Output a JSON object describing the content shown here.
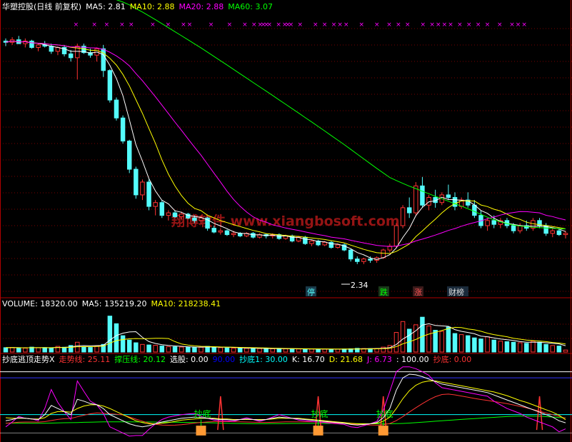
{
  "main": {
    "title": "华塑控股(日线 前复权)",
    "ma": [
      {
        "label": "MA5:",
        "value": "2.81",
        "color": "#ffffff"
      },
      {
        "label": "MA10:",
        "value": "2.88",
        "color": "#ffff00"
      },
      {
        "label": "MA20:",
        "value": "2.88",
        "color": "#ff00ff"
      },
      {
        "label": "MA60:",
        "value": "3.07",
        "color": "#00ff00"
      }
    ],
    "low_label": "2.34",
    "watermark": "翔博软件 www.xiangbosoft.com",
    "event_markers": [
      "停",
      "跌",
      "涨",
      "财榜"
    ]
  },
  "volume": {
    "items": [
      {
        "label": "VOLUME:",
        "value": "18320.00",
        "color": "#ffffff"
      },
      {
        "label": "MA5:",
        "value": "135219.20",
        "color": "#ffffff"
      },
      {
        "label": "MA10:",
        "value": "218238.41",
        "color": "#ffff00"
      }
    ]
  },
  "indicator": {
    "title": "抄底逃顶走势X",
    "items": [
      {
        "label": "走势线:",
        "value": "25.11",
        "color": "#ff3333"
      },
      {
        "label": "撑压线:",
        "value": "20.12",
        "color": "#00ff00"
      },
      {
        "label": "选股:",
        "value": "0.00",
        "color": "#ffffff"
      },
      {
        "label": "",
        "value": "90.00",
        "color": "#0000ff"
      },
      {
        "label": "抄底1:",
        "value": "30.00",
        "color": "#00ffff"
      },
      {
        "label": "K:",
        "value": "16.70",
        "color": "#ffffff"
      },
      {
        "label": "D:",
        "value": "21.68",
        "color": "#ffff00"
      },
      {
        "label": "J:",
        "value": "6.73",
        "color": "#ff00ff"
      },
      {
        "label": ":",
        "value": "100.00",
        "color": "#ffffff"
      },
      {
        "label": "抄底:",
        "value": "0.00",
        "color": "#ff3333"
      }
    ],
    "signal_label": "抄底"
  },
  "colors": {
    "up": "#ff3333",
    "down": "#54fcfc",
    "ma5": "#ffffff",
    "ma10": "#ffff00",
    "ma20": "#ff00ff",
    "ma60": "#00ff00"
  },
  "chart_data": {
    "type": "candlestick",
    "ylim": [
      2.2,
      4.3
    ],
    "candles": [
      [
        4.08,
        4.1,
        4.04,
        4.07
      ],
      [
        4.07,
        4.11,
        4.05,
        4.09
      ],
      [
        4.09,
        4.12,
        4.06,
        4.06
      ],
      [
        4.06,
        4.1,
        4.03,
        4.08
      ],
      [
        4.08,
        4.09,
        4.02,
        4.03
      ],
      [
        4.03,
        4.06,
        4.0,
        4.05
      ],
      [
        4.05,
        4.08,
        4.03,
        4.04
      ],
      [
        4.04,
        4.06,
        3.98,
        4.0
      ],
      [
        4.0,
        4.04,
        3.97,
        4.03
      ],
      [
        4.03,
        4.05,
        3.96,
        3.98
      ],
      [
        3.98,
        4.01,
        3.92,
        3.95
      ],
      [
        3.95,
        4.06,
        3.78,
        4.04
      ],
      [
        4.04,
        4.06,
        3.98,
        3.99
      ],
      [
        3.99,
        4.02,
        3.95,
        3.97
      ],
      [
        3.97,
        4.03,
        3.92,
        4.02
      ],
      [
        4.02,
        4.05,
        3.8,
        3.85
      ],
      [
        3.85,
        3.86,
        3.6,
        3.62
      ],
      [
        3.62,
        3.64,
        3.46,
        3.48
      ],
      [
        3.48,
        3.5,
        3.28,
        3.3
      ],
      [
        3.3,
        3.31,
        3.05,
        3.08
      ],
      [
        3.08,
        3.1,
        2.85,
        2.88
      ],
      [
        2.88,
        3.0,
        2.84,
        2.98
      ],
      [
        2.98,
        3.0,
        2.76,
        2.79
      ],
      [
        2.79,
        2.84,
        2.72,
        2.82
      ],
      [
        2.82,
        2.84,
        2.7,
        2.72
      ],
      [
        2.72,
        2.76,
        2.68,
        2.74
      ],
      [
        2.74,
        2.76,
        2.7,
        2.71
      ],
      [
        2.71,
        2.75,
        2.69,
        2.73
      ],
      [
        2.73,
        2.74,
        2.69,
        2.7
      ],
      [
        2.7,
        2.72,
        2.66,
        2.68
      ],
      [
        2.68,
        2.72,
        2.66,
        2.7
      ],
      [
        2.7,
        2.71,
        2.6,
        2.62
      ],
      [
        2.62,
        2.64,
        2.58,
        2.59
      ],
      [
        2.59,
        2.62,
        2.57,
        2.6
      ],
      [
        2.6,
        2.61,
        2.56,
        2.57
      ],
      [
        2.57,
        2.6,
        2.55,
        2.58
      ],
      [
        2.58,
        2.59,
        2.55,
        2.56
      ],
      [
        2.56,
        2.59,
        2.55,
        2.58
      ],
      [
        2.58,
        2.59,
        2.54,
        2.55
      ],
      [
        2.55,
        2.58,
        2.54,
        2.57
      ],
      [
        2.57,
        2.58,
        2.54,
        2.56
      ],
      [
        2.56,
        2.58,
        2.54,
        2.57
      ],
      [
        2.57,
        2.58,
        2.53,
        2.54
      ],
      [
        2.54,
        2.57,
        2.53,
        2.56
      ],
      [
        2.56,
        2.57,
        2.51,
        2.52
      ],
      [
        2.52,
        2.56,
        2.51,
        2.55
      ],
      [
        2.55,
        2.56,
        2.49,
        2.5
      ],
      [
        2.5,
        2.53,
        2.48,
        2.52
      ],
      [
        2.52,
        2.53,
        2.48,
        2.49
      ],
      [
        2.49,
        2.52,
        2.48,
        2.51
      ],
      [
        2.51,
        2.52,
        2.46,
        2.47
      ],
      [
        2.47,
        2.5,
        2.46,
        2.49
      ],
      [
        2.49,
        2.5,
        2.44,
        2.45
      ],
      [
        2.45,
        2.46,
        2.36,
        2.38
      ],
      [
        2.38,
        2.4,
        2.34,
        2.36
      ],
      [
        2.36,
        2.39,
        2.34,
        2.38
      ],
      [
        2.38,
        2.4,
        2.35,
        2.37
      ],
      [
        2.37,
        2.4,
        2.35,
        2.39
      ],
      [
        2.39,
        2.46,
        2.38,
        2.45
      ],
      [
        2.45,
        2.5,
        2.43,
        2.48
      ],
      [
        2.48,
        2.66,
        2.47,
        2.64
      ],
      [
        2.64,
        2.8,
        2.62,
        2.78
      ],
      [
        2.78,
        2.86,
        2.7,
        2.74
      ],
      [
        2.74,
        2.98,
        2.72,
        2.95
      ],
      [
        2.95,
        3.02,
        2.78,
        2.8
      ],
      [
        2.8,
        2.88,
        2.76,
        2.86
      ],
      [
        2.86,
        2.92,
        2.78,
        2.82
      ],
      [
        2.82,
        2.9,
        2.8,
        2.88
      ],
      [
        2.88,
        2.96,
        2.84,
        2.86
      ],
      [
        2.86,
        2.9,
        2.76,
        2.79
      ],
      [
        2.79,
        2.86,
        2.77,
        2.84
      ],
      [
        2.84,
        2.9,
        2.78,
        2.8
      ],
      [
        2.8,
        2.84,
        2.7,
        2.72
      ],
      [
        2.72,
        2.76,
        2.62,
        2.64
      ],
      [
        2.64,
        2.7,
        2.6,
        2.68
      ],
      [
        2.68,
        2.72,
        2.62,
        2.65
      ],
      [
        2.65,
        2.7,
        2.62,
        2.68
      ],
      [
        2.68,
        2.7,
        2.62,
        2.64
      ],
      [
        2.64,
        2.66,
        2.58,
        2.6
      ],
      [
        2.6,
        2.66,
        2.58,
        2.64
      ],
      [
        2.64,
        2.68,
        2.6,
        2.62
      ],
      [
        2.62,
        2.7,
        2.6,
        2.68
      ],
      [
        2.68,
        2.7,
        2.62,
        2.64
      ],
      [
        2.64,
        2.66,
        2.56,
        2.58
      ],
      [
        2.58,
        2.62,
        2.55,
        2.6
      ],
      [
        2.6,
        2.62,
        2.56,
        2.57
      ],
      [
        2.57,
        2.6,
        2.54,
        2.58
      ]
    ],
    "volume_ylim": [
      0,
      400000
    ],
    "volume": [
      40000,
      42000,
      38000,
      36000,
      45000,
      39000,
      41000,
      37000,
      52000,
      44000,
      60000,
      90000,
      48000,
      42000,
      56000,
      70000,
      330000,
      260000,
      150000,
      110000,
      85000,
      70000,
      65000,
      62000,
      55000,
      50000,
      48000,
      46000,
      45000,
      42000,
      44000,
      52000,
      46000,
      40000,
      38000,
      36000,
      35000,
      34000,
      33000,
      32000,
      31000,
      30000,
      30000,
      29000,
      30000,
      28000,
      27000,
      28000,
      26000,
      27000,
      25000,
      26000,
      28000,
      30000,
      34000,
      32000,
      31000,
      33000,
      45000,
      60000,
      180000,
      280000,
      210000,
      250000,
      320000,
      240000,
      200000,
      190000,
      230000,
      170000,
      160000,
      150000,
      130000,
      120000,
      140000,
      110000,
      100000,
      95000,
      90000,
      85000,
      80000,
      100000,
      90000,
      70000,
      60000,
      55000,
      18320
    ],
    "indicator_ylim": [
      -10,
      110
    ],
    "k": [
      20,
      22,
      25,
      24,
      23,
      22,
      30,
      45,
      40,
      35,
      30,
      55,
      52,
      48,
      46,
      40,
      30,
      25,
      20,
      15,
      12,
      10,
      12,
      15,
      18,
      20,
      22,
      24,
      25,
      26,
      25,
      24,
      23,
      22,
      22,
      21,
      22,
      23,
      22,
      21,
      22,
      24,
      26,
      25,
      24,
      23,
      22,
      21,
      20,
      19,
      18,
      17,
      16,
      14,
      13,
      14,
      15,
      17,
      25,
      40,
      70,
      90,
      96,
      95,
      92,
      88,
      84,
      80,
      78,
      76,
      74,
      72,
      70,
      68,
      66,
      62,
      58,
      54,
      50,
      46,
      42,
      38,
      34,
      30,
      26,
      20,
      16.7
    ],
    "d": [
      25,
      24,
      24,
      24,
      23,
      23,
      25,
      32,
      35,
      35,
      34,
      40,
      44,
      46,
      46,
      44,
      40,
      35,
      30,
      25,
      20,
      17,
      15,
      15,
      16,
      17,
      19,
      21,
      22,
      23,
      24,
      24,
      24,
      23,
      23,
      22,
      22,
      22,
      22,
      22,
      22,
      23,
      24,
      24,
      24,
      24,
      23,
      22,
      21,
      20,
      19,
      18,
      17,
      16,
      15,
      15,
      15,
      16,
      19,
      26,
      40,
      56,
      69,
      78,
      83,
      85,
      85,
      83,
      81,
      79,
      77,
      75,
      73,
      71,
      69,
      67,
      64,
      61,
      57,
      53,
      50,
      46,
      42,
      38,
      34,
      29,
      21.68
    ],
    "j": [
      10,
      18,
      27,
      24,
      23,
      20,
      40,
      71,
      50,
      35,
      22,
      85,
      68,
      52,
      46,
      32,
      10,
      5,
      0,
      -5,
      -4,
      -4,
      6,
      15,
      22,
      26,
      28,
      30,
      31,
      32,
      27,
      24,
      21,
      20,
      20,
      19,
      22,
      25,
      22,
      19,
      22,
      26,
      30,
      27,
      24,
      21,
      20,
      19,
      18,
      17,
      16,
      15,
      14,
      10,
      9,
      12,
      15,
      19,
      37,
      68,
      100,
      108,
      108,
      105,
      100,
      94,
      82,
      74,
      72,
      70,
      68,
      66,
      64,
      62,
      60,
      52,
      46,
      40,
      36,
      32,
      26,
      22,
      18,
      14,
      10,
      2,
      6.73
    ],
    "signals": [
      30,
      48,
      58
    ],
    "spikes": [
      33,
      48,
      58,
      82,
      90
    ]
  }
}
